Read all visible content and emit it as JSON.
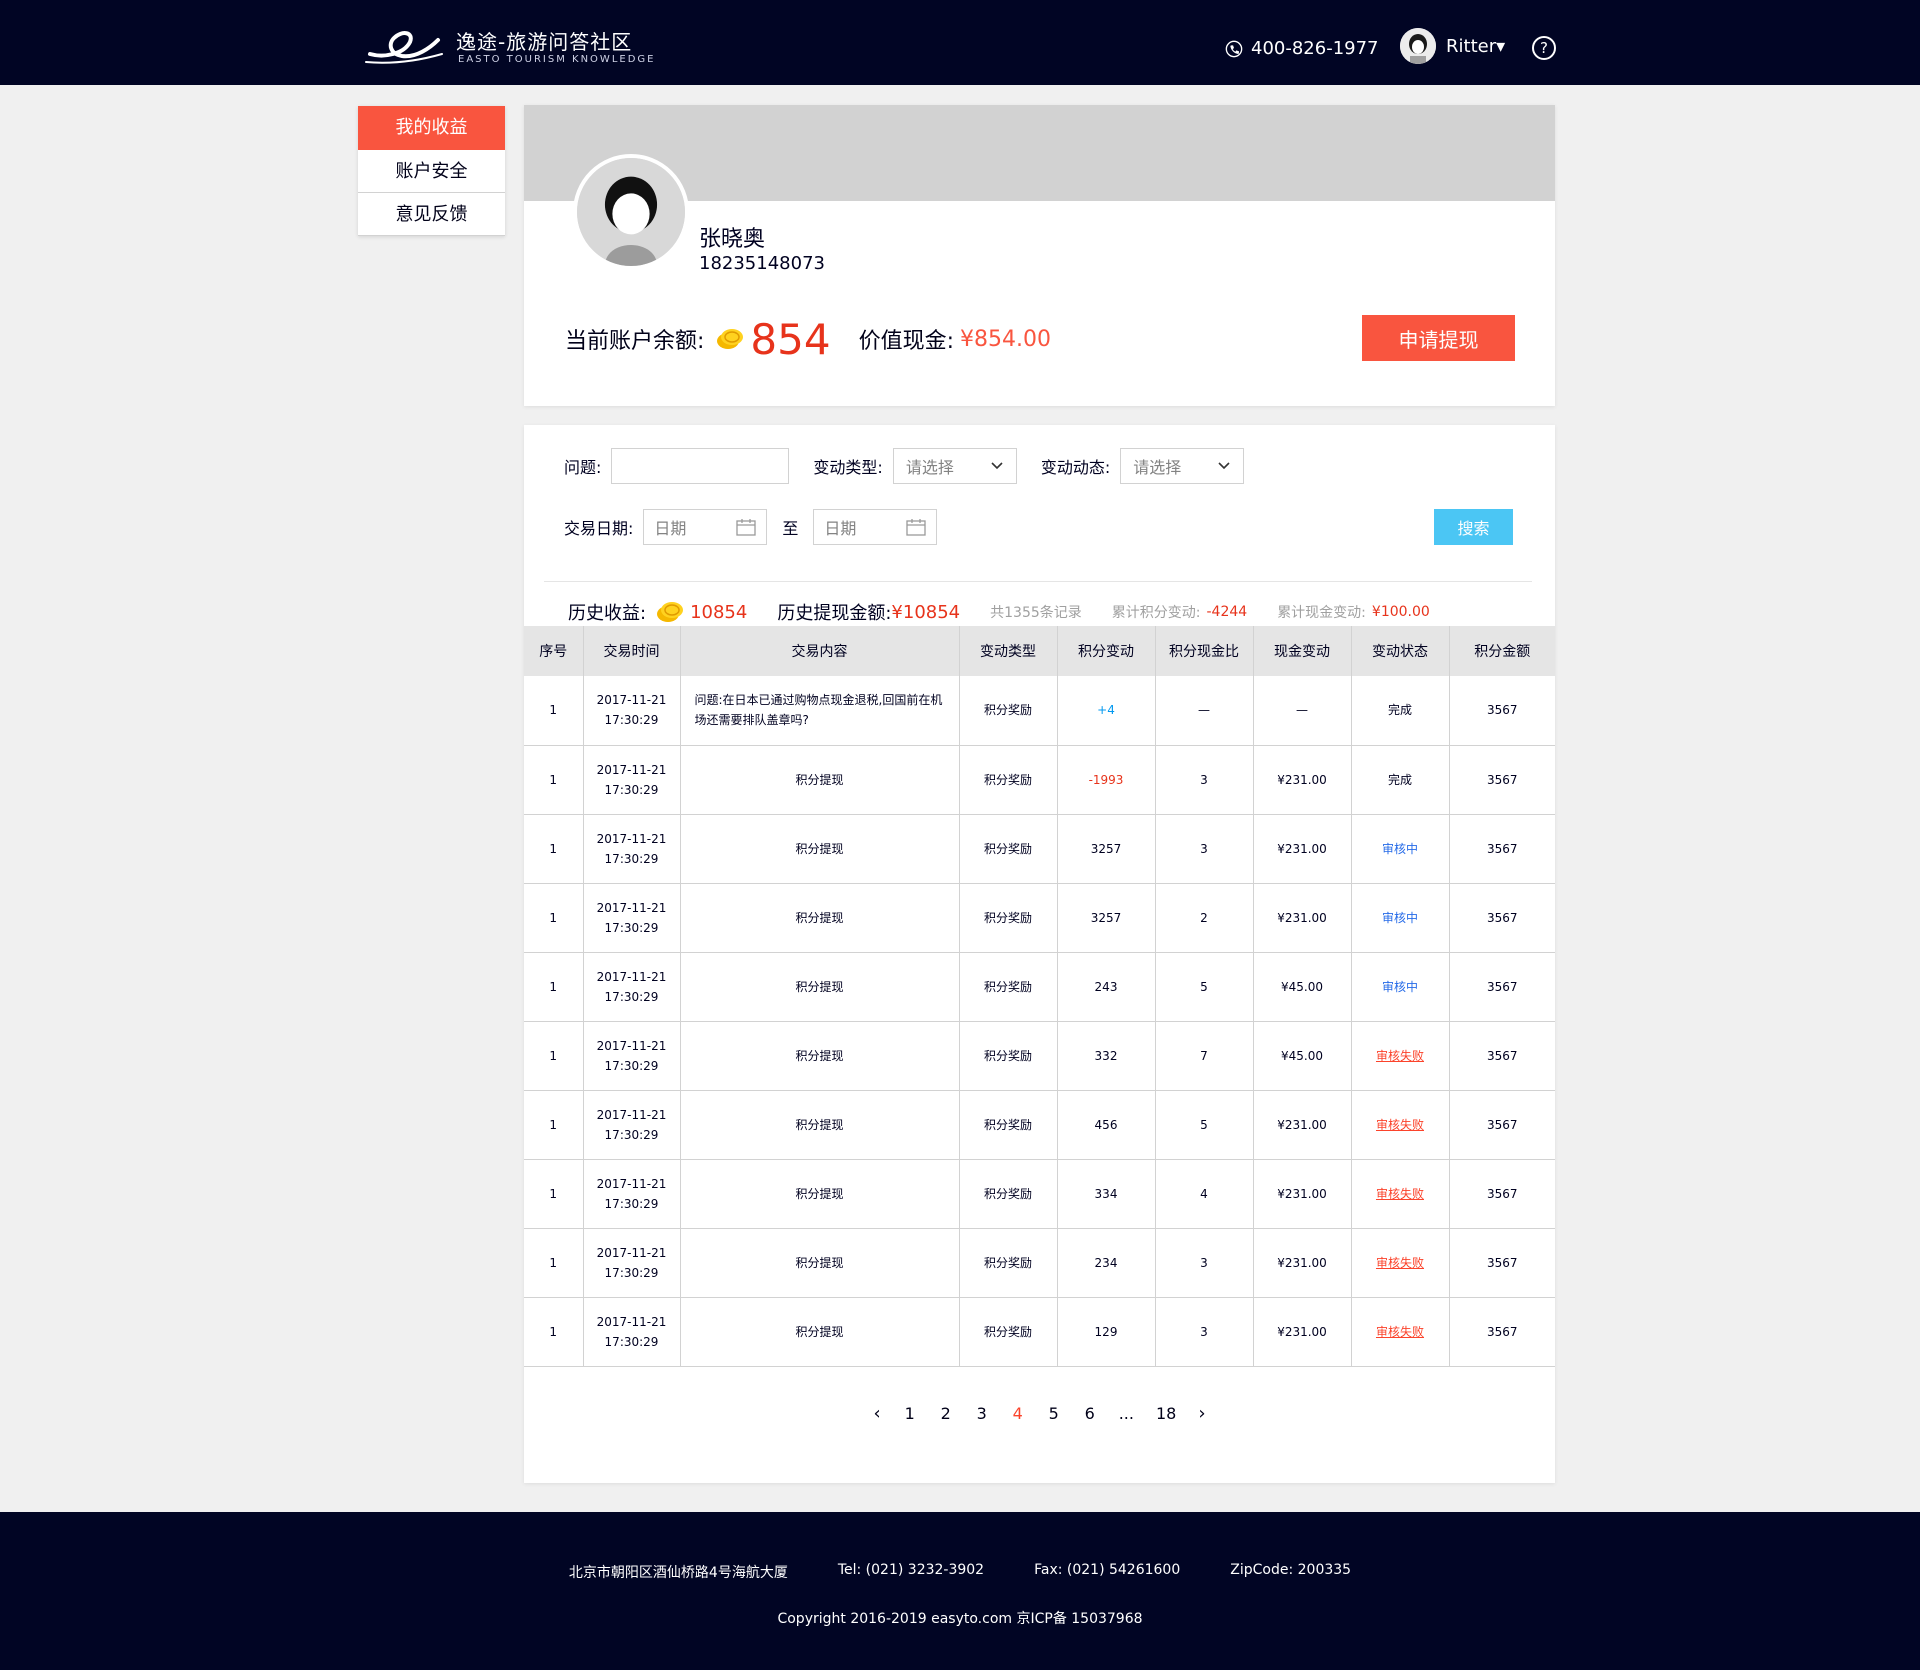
{
  "header": {
    "site_title": "逸途-旅游问答社区",
    "site_subtitle": "EASTO TOURISM KNOWLEDGE",
    "phone": "400-826-1977",
    "username": "Ritter▾",
    "help_label": "?"
  },
  "sidebar": {
    "items": [
      {
        "label": "我的收益"
      },
      {
        "label": "账户安全"
      },
      {
        "label": "意见反馈"
      }
    ]
  },
  "profile": {
    "name": "张晓奥",
    "phone": "18235148073",
    "balance_label": "当前账户余额:",
    "balance_value": "854",
    "cash_label": "价值现金:",
    "cash_value": "¥854.00",
    "withdraw_label": "申请提现"
  },
  "filters": {
    "question_label": "问题:",
    "question_value": "",
    "change_type_label": "变动类型:",
    "change_type_placeholder": "请选择",
    "change_status_label": "变动动态:",
    "change_status_placeholder": "请选择",
    "date_label": "交易日期:",
    "date_from_placeholder": "日期",
    "date_to_label": "至",
    "date_to_placeholder": "日期",
    "search_label": "搜索"
  },
  "summary": {
    "history_income_label": "历史收益:",
    "history_income_value": "10854",
    "history_withdraw_label": "历史提现金额:",
    "history_withdraw_value": "¥10854",
    "total_records": "共1355条记录",
    "points_change_label": "累计积分变动:",
    "points_change_value": "-4244",
    "cash_change_label": "累计现金变动:",
    "cash_change_value": "¥100.00"
  },
  "table": {
    "headers": [
      "序号",
      "交易时间",
      "交易内容",
      "变动类型",
      "积分变动",
      "积分现金比",
      "现金变动",
      "变动状态",
      "积分金额"
    ],
    "rows": [
      {
        "no": "1",
        "date": "2017-11-21",
        "time": "17:30:29",
        "content": "问题:在日本已通过购物点现金退税,回国前在机场还需要排队盖章吗?",
        "type": "积分奖励",
        "points": "+4",
        "ratio": "—",
        "cash": "—",
        "status": "完成",
        "amount": "3567"
      },
      {
        "no": "1",
        "date": "2017-11-21",
        "time": "17:30:29",
        "content": "积分提现",
        "type": "积分奖励",
        "points": "-1993",
        "ratio": "3",
        "cash": "¥231.00",
        "status": "完成",
        "amount": "3567"
      },
      {
        "no": "1",
        "date": "2017-11-21",
        "time": "17:30:29",
        "content": "积分提现",
        "type": "积分奖励",
        "points": "3257",
        "ratio": "3",
        "cash": "¥231.00",
        "status": "审核中",
        "amount": "3567"
      },
      {
        "no": "1",
        "date": "2017-11-21",
        "time": "17:30:29",
        "content": "积分提现",
        "type": "积分奖励",
        "points": "3257",
        "ratio": "2",
        "cash": "¥231.00",
        "status": "审核中",
        "amount": "3567"
      },
      {
        "no": "1",
        "date": "2017-11-21",
        "time": "17:30:29",
        "content": "积分提现",
        "type": "积分奖励",
        "points": "243",
        "ratio": "5",
        "cash": "¥45.00",
        "status": "审核中",
        "amount": "3567"
      },
      {
        "no": "1",
        "date": "2017-11-21",
        "time": "17:30:29",
        "content": "积分提现",
        "type": "积分奖励",
        "points": "332",
        "ratio": "7",
        "cash": "¥45.00",
        "status": "审核失败",
        "amount": "3567"
      },
      {
        "no": "1",
        "date": "2017-11-21",
        "time": "17:30:29",
        "content": "积分提现",
        "type": "积分奖励",
        "points": "456",
        "ratio": "5",
        "cash": "¥231.00",
        "status": "审核失败",
        "amount": "3567"
      },
      {
        "no": "1",
        "date": "2017-11-21",
        "time": "17:30:29",
        "content": "积分提现",
        "type": "积分奖励",
        "points": "334",
        "ratio": "4",
        "cash": "¥231.00",
        "status": "审核失败",
        "amount": "3567"
      },
      {
        "no": "1",
        "date": "2017-11-21",
        "time": "17:30:29",
        "content": "积分提现",
        "type": "积分奖励",
        "points": "234",
        "ratio": "3",
        "cash": "¥231.00",
        "status": "审核失败",
        "amount": "3567"
      },
      {
        "no": "1",
        "date": "2017-11-21",
        "time": "17:30:29",
        "content": "积分提现",
        "type": "积分奖励",
        "points": "129",
        "ratio": "3",
        "cash": "¥231.00",
        "status": "审核失败",
        "amount": "3567"
      }
    ]
  },
  "pagination": {
    "prev": "‹",
    "next": "›",
    "pages": [
      "1",
      "2",
      "3",
      "4",
      "5",
      "6",
      "...",
      "18"
    ],
    "current": "4"
  },
  "footer": {
    "address": "北京市朝阳区酒仙桥路4号海航大厦",
    "tel": "Tel: (021) 3232-3902",
    "fax": "Fax: (021) 54261600",
    "zip": "ZipCode: 200335",
    "copyright": "Copyright 2016-2019 easyto.com 京ICP备 15037968"
  },
  "colors": {
    "header_bg": "#010524",
    "accent_red": "#f9553f",
    "amount_red": "#e7331b",
    "search_blue": "#4bc6f4",
    "audit_blue": "#266be8",
    "fail_red": "#fb432b",
    "divider_gray": "#d2d2d2",
    "table_header_bg": "#e5e5e5"
  }
}
